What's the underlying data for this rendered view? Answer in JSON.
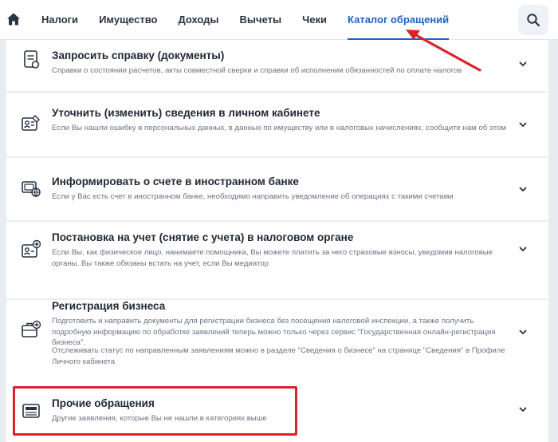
{
  "nav": {
    "items": [
      {
        "label": "Налоги"
      },
      {
        "label": "Имущество"
      },
      {
        "label": "Доходы"
      },
      {
        "label": "Вычеты"
      },
      {
        "label": "Чеки"
      },
      {
        "label": "Каталог обращений"
      }
    ],
    "active_index": 5
  },
  "catalog": [
    {
      "title": "Запросить справку (документы)",
      "desc": "Справки о состоянии расчетов, акты совместной сверки и справки об исполнении обязанностей по оплате налогов",
      "icon": "document-icon"
    },
    {
      "title": "Уточнить (изменить) сведения в личном кабинете",
      "desc": "Если Вы нашли ошибку в персональных данных, в данных по имуществу или в налоговых начислениях, сообщите нам об этом",
      "icon": "id-card-edit-icon"
    },
    {
      "title": "Информировать о счете в иностранном банке",
      "desc": "Если у Вас есть счет в иностранном банке, необходимо направить уведомление об операциях с такими счетами",
      "icon": "foreign-bank-icon"
    },
    {
      "title": "Постановка на учет (снятие с учета) в налоговом органе",
      "desc": "Если Вы, как физическое лицо, нанимаете помощника, Вы можете платить за него страховые взносы, уведомив налоговые органы. Вы также обязаны встать на учет, если Вы медиатор",
      "icon": "id-card-add-icon"
    },
    {
      "title": "Регистрация бизнеса",
      "desc": "Подготовить и направить документы для регистрации бизнеса без посещения налоговой инспекции, а также получить подробную информацию по обработке заявлений теперь можно только через сервис \"Государственная онлайн-регистрация бизнеса\".",
      "desc2": "Отслеживать статус по направленным заявлениям можно в разделе \"Сведения о бизнесе\" на странице \"Сведения\" в Профиле Личного кабинета",
      "icon": "business-case-icon"
    },
    {
      "title": "Прочие обращения",
      "desc": "Другие заявления, которые Вы не нашли в категориях выше",
      "icon": "inbox-tray-icon"
    }
  ],
  "colors": {
    "accent": "#1c63c7",
    "highlight": "#d9232b"
  }
}
